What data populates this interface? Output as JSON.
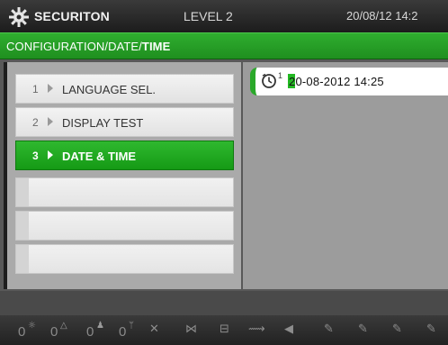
{
  "header": {
    "brand": "SECURITON",
    "level": "LEVEL 2",
    "datetime": "20/08/12 14:2",
    "logo_icon": "gear-icon"
  },
  "breadcrumb": {
    "prefix": "CONFIGURATION/DATE/",
    "current": "TIME"
  },
  "menu": {
    "items": [
      {
        "number": "1",
        "label": "LANGUAGE SEL.",
        "selected": false
      },
      {
        "number": "2",
        "label": "DISPLAY TEST",
        "selected": false
      },
      {
        "number": "3",
        "label": "DATE & TIME",
        "selected": true
      }
    ]
  },
  "value_field": {
    "icon": "clock-icon",
    "icon_superscript": "1",
    "cursor_char": "2",
    "value_rest": "0-08-2012  14:25"
  },
  "bottom_bar": {
    "counters": [
      "0",
      "0",
      "0",
      "0"
    ],
    "counter_icons": [
      "sun-icon",
      "warning-triangle-icon",
      "person-icon",
      "wrench-icon"
    ],
    "status_icons": [
      "horn-off-icon",
      "relay-off-icon",
      "printer-icon",
      "transmission-icon",
      "buzzer-icon",
      "document-edit-icon",
      "document-edit-2-icon",
      "document-edit-3-icon"
    ]
  },
  "colors": {
    "accent_green": "#1f9a1f",
    "header_bg": "#1c1c1c",
    "panel_gray": "#9c9c9c"
  }
}
